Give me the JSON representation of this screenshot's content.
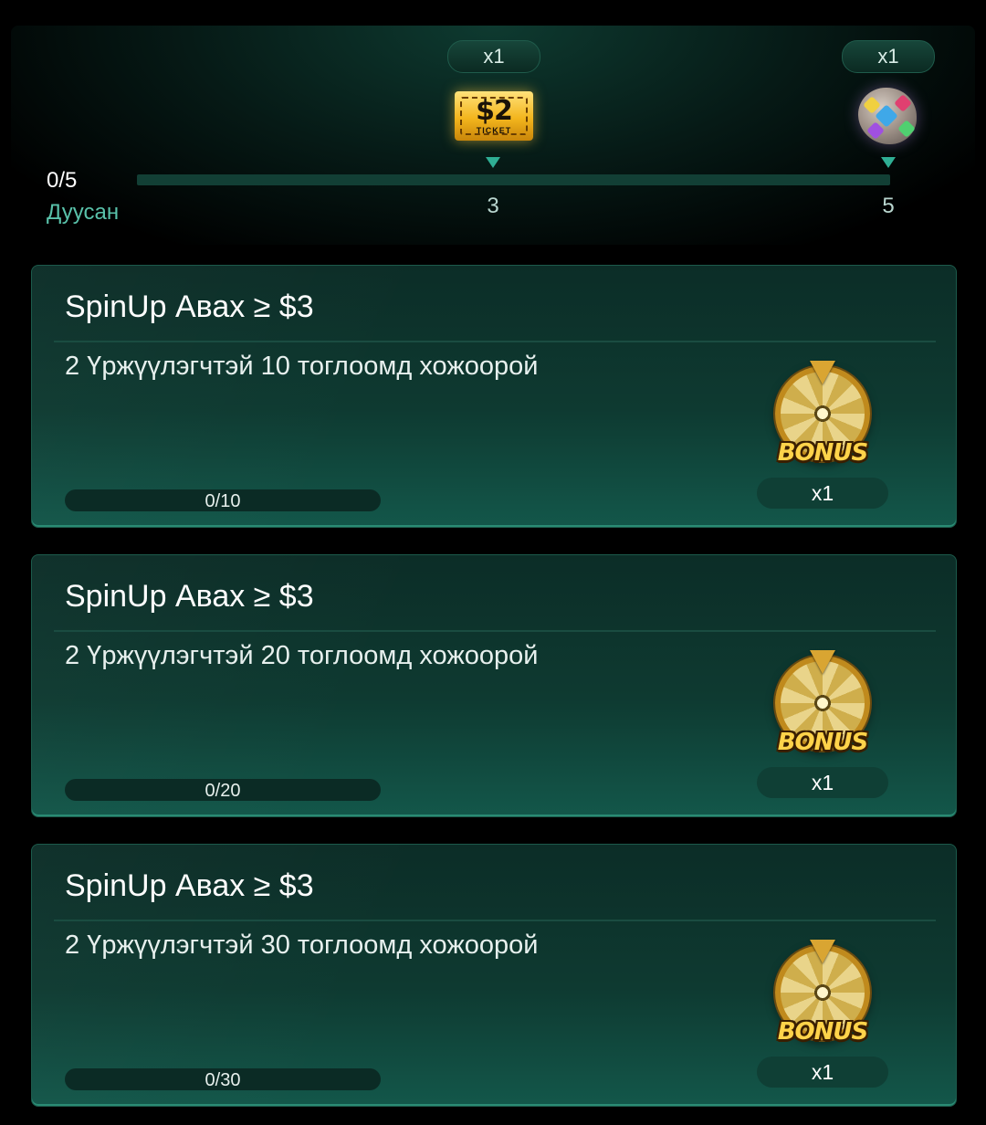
{
  "milestones": {
    "progress_count": "0/5",
    "progress_label": "Дуусан",
    "progress_fraction": 0,
    "rewards": [
      {
        "step": "3",
        "quantity": "x1",
        "icon": "ticket-2-dollar-icon",
        "ticket_value": "$2",
        "ticket_label": "TICKET"
      },
      {
        "step": "5",
        "quantity": "x1",
        "icon": "gem-rock-icon"
      }
    ]
  },
  "tasks": [
    {
      "title": "SpinUp Авах ≥ $3",
      "description": "2 Үржүүлэгчтэй 10 тоглоомд хожоорой",
      "progress_text": "0/10",
      "progress_fraction": 0,
      "reward_icon": "bonus-wheel-icon",
      "reward_label": "BONUS",
      "reward_quantity": "x1"
    },
    {
      "title": "SpinUp Авах ≥ $3",
      "description": "2 Үржүүлэгчтэй 20 тоглоомд хожоорой",
      "progress_text": "0/20",
      "progress_fraction": 0,
      "reward_icon": "bonus-wheel-icon",
      "reward_label": "BONUS",
      "reward_quantity": "x1"
    },
    {
      "title": "SpinUp Авах ≥ $3",
      "description": "2 Үржүүлэгчтэй 30 тоглоомд хожоорой",
      "progress_text": "0/30",
      "progress_fraction": 0,
      "reward_icon": "bonus-wheel-icon",
      "reward_label": "BONUS",
      "reward_quantity": "x1"
    }
  ],
  "colors": {
    "accent": "#2fae94",
    "progress_label": "#59c2aa",
    "card_bg": "#0e3a31",
    "gold": "#f3b51d"
  }
}
